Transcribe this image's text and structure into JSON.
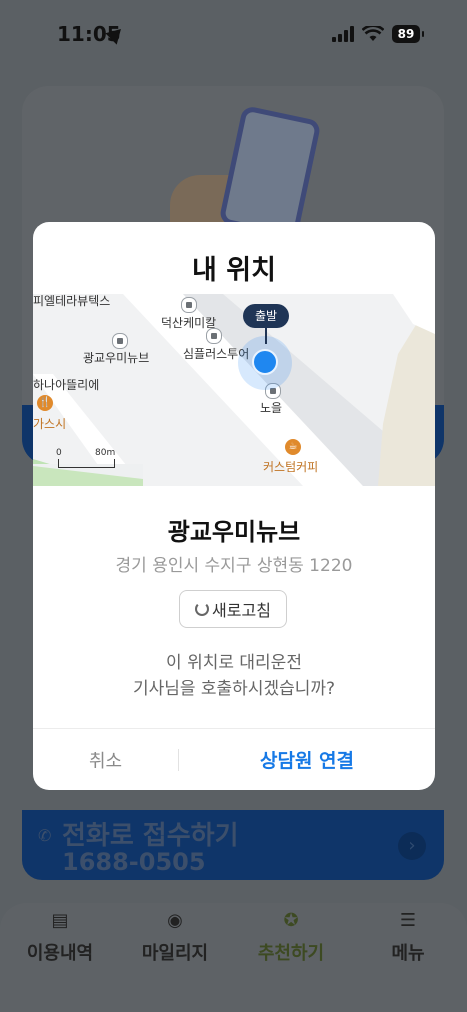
{
  "status_bar": {
    "time": "11:05",
    "battery": "89"
  },
  "background": {
    "phone_card_title": "전화로 접수하기",
    "phone_number": "1688-0505"
  },
  "tabbar": {
    "items": [
      {
        "label": "이용내역",
        "icon": "receipt-icon"
      },
      {
        "label": "마일리지",
        "icon": "mileage-coin-icon"
      },
      {
        "label": "추천하기",
        "icon": "star-badge-icon",
        "active": true
      },
      {
        "label": "메뉴",
        "icon": "hamburger-menu-icon"
      }
    ]
  },
  "modal": {
    "title": "내 위치",
    "map": {
      "labels": [
        "피엘테라뷰텍스",
        "덕산케미칼",
        "광교우미뉴브",
        "심플러스투어",
        "하나아뜰리에",
        "가스시",
        "노을",
        "커스텀커피"
      ],
      "depart_label": "출발",
      "scale": {
        "start": "0",
        "end": "80m"
      }
    },
    "place_name": "광교우미뉴브",
    "address": "경기 용인시 수지구 상현동 1220",
    "refresh_label": "새로고침",
    "question_line1": "이 위치로 대리운전",
    "question_line2": "기사님을 호출하시겠습니까?",
    "cancel_label": "취소",
    "connect_label": "상담원 연결"
  },
  "colors": {
    "accent": "#1679e6",
    "my_location": "#1f87f0",
    "depart_bubble": "#1f3556",
    "overlay": "#5b6064",
    "active_tab": "#3d4a22"
  }
}
